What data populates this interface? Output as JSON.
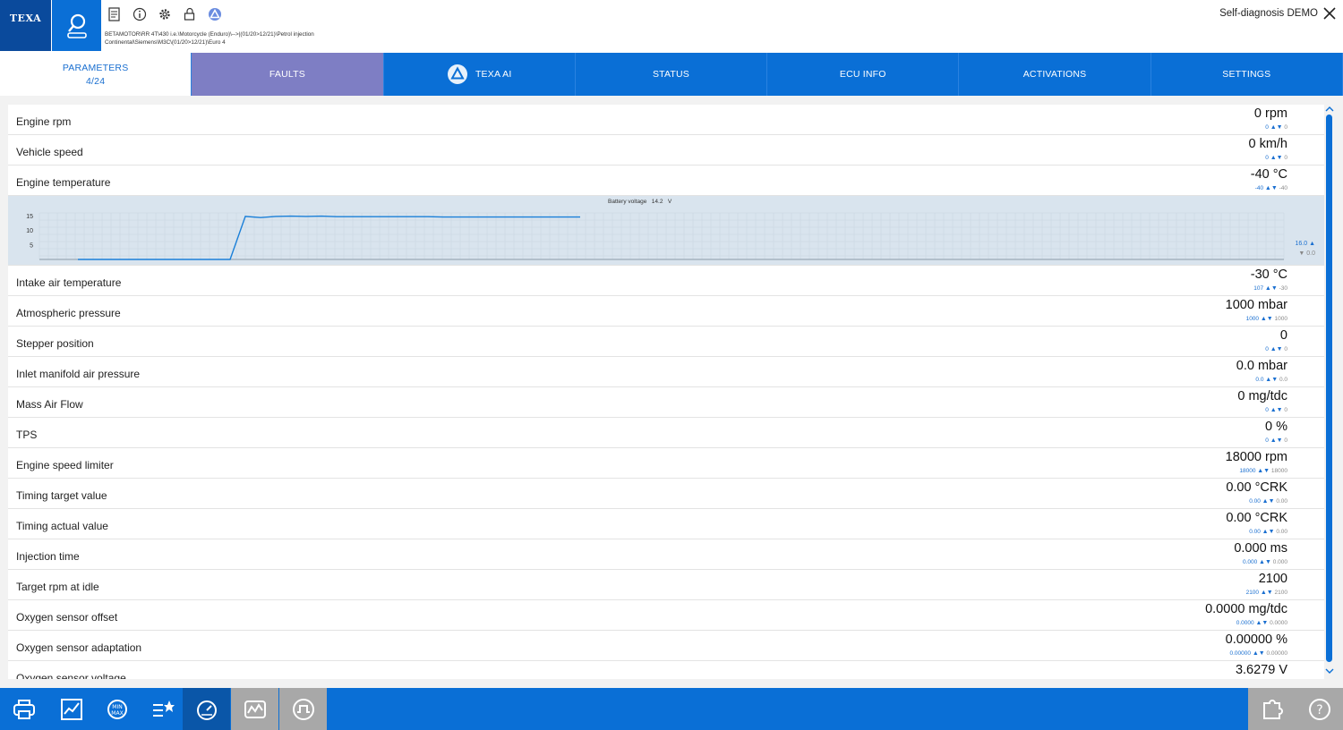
{
  "header": {
    "logo_text": "TEXA",
    "vehicle_path_line1": "BETAMOTOR\\RR 4T\\430 i.e.\\Motorcycle (Enduro)\\-->|(01/20>12/21)\\Petrol injection",
    "vehicle_path_line2": "Continental\\Siemens\\M3C\\(01/20>12/21)\\Euro 4",
    "session_title": "Self-diagnosis DEMO",
    "tool_icons": [
      "report-icon",
      "info-icon",
      "gear-icon",
      "lock-icon",
      "texa-ai-icon"
    ]
  },
  "tabs": [
    {
      "label": "PARAMETERS",
      "sub": "4/24"
    },
    {
      "label": "FAULTS"
    },
    {
      "label": "TEXA AI"
    },
    {
      "label": "STATUS"
    },
    {
      "label": "ECU INFO"
    },
    {
      "label": "ACTIVATIONS"
    },
    {
      "label": "SETTINGS"
    }
  ],
  "parameters": [
    {
      "name": "Engine rpm",
      "value": "0 rpm",
      "max": "0",
      "min": "0"
    },
    {
      "name": "Vehicle speed",
      "value": "0 km/h",
      "max": "0",
      "min": "0"
    },
    {
      "name": "Engine temperature",
      "value": "-40 °C",
      "max": "-40",
      "min": "-40"
    },
    {
      "name": "Intake air temperature",
      "value": "-30 °C",
      "max": "107",
      "min": "-30"
    },
    {
      "name": "Atmospheric pressure",
      "value": "1000 mbar",
      "max": "1000",
      "min": "1000"
    },
    {
      "name": "Stepper position",
      "value": "0",
      "max": "0",
      "min": "0"
    },
    {
      "name": "Inlet manifold air pressure",
      "value": "0.0 mbar",
      "max": "0.0",
      "min": "0.0"
    },
    {
      "name": "Mass Air Flow",
      "value": "0 mg/tdc",
      "max": "0",
      "min": "0"
    },
    {
      "name": "TPS",
      "value": "0 %",
      "max": "0",
      "min": "0"
    },
    {
      "name": "Engine speed limiter",
      "value": "18000 rpm",
      "max": "18000",
      "min": "18000"
    },
    {
      "name": "Timing target value",
      "value": "0.00 °CRK",
      "max": "0.00",
      "min": "0.00"
    },
    {
      "name": "Timing actual value",
      "value": "0.00 °CRK",
      "max": "0.00",
      "min": "0.00"
    },
    {
      "name": "Injection time",
      "value": "0.000 ms",
      "max": "0.000",
      "min": "0.000"
    },
    {
      "name": "Target rpm at idle",
      "value": "2100",
      "max": "2100",
      "min": "2100"
    },
    {
      "name": "Oxygen sensor offset",
      "value": "0.0000 mg/tdc",
      "max": "0.0000",
      "min": "0.0000"
    },
    {
      "name": "Oxygen sensor adaptation",
      "value": "0.00000 %",
      "max": "0.00000",
      "min": "0.00000"
    },
    {
      "name": "Oxygen sensor voltage",
      "value": "3.6279 V",
      "max": "",
      "min": ""
    }
  ],
  "graph": {
    "title": "Battery voltage",
    "current_value": "14.2",
    "unit": "V",
    "y_ticks": [
      "15",
      "10",
      "5"
    ],
    "max_label": "16.0",
    "min_label": "0.0",
    "ymin": 0,
    "ymax": 16,
    "samples": [
      0,
      0,
      0,
      0,
      0,
      0,
      0,
      0,
      0,
      0,
      0,
      14.8,
      14.4,
      14.8,
      14.9,
      14.8,
      14.9,
      14.7,
      14.7,
      14.7,
      14.7,
      14.7,
      14.7,
      14.7,
      14.6,
      14.6,
      14.6,
      14.6,
      14.6,
      14.6,
      14.6,
      14.6,
      14.6,
      14.6
    ],
    "color": "#1a7fd8"
  },
  "bottom_toolbar": [
    "print-icon",
    "chart-edit-icon",
    "min-max-icon",
    "favorites-icon",
    "gauge-icon",
    "graph-icon",
    "signal-icon",
    "puzzle-icon",
    "help-icon"
  ],
  "colors": {
    "primary": "#0a6fd6",
    "faults_tab": "#7e7ec4",
    "logo": "#0a4a9c"
  }
}
